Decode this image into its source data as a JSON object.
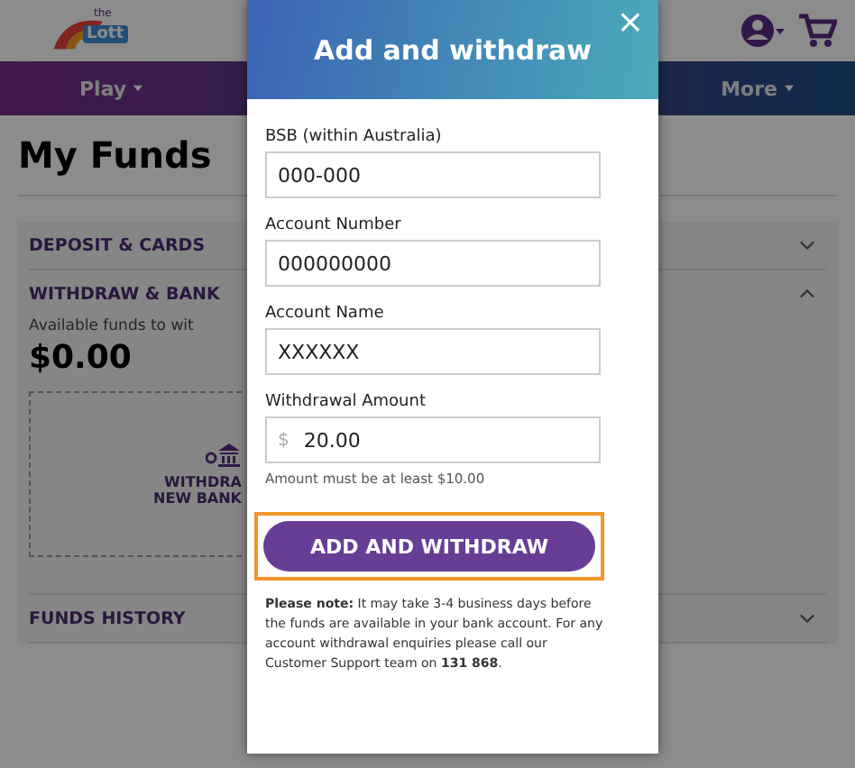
{
  "header": {
    "logo": {
      "small": "the",
      "big": "Lott"
    }
  },
  "nav": [
    {
      "label": "Play"
    },
    {
      "label": "More"
    }
  ],
  "page": {
    "title": "My Funds",
    "sections": [
      {
        "title": "DEPOSIT & CARDS",
        "expanded": false
      },
      {
        "title": "WITHDRAW & BANK",
        "expanded": true,
        "available_label": "Available funds to wit",
        "amount": "$0.00",
        "add_card": [
          "WITHDRA",
          "NEW BANK"
        ]
      },
      {
        "title": "FUNDS HISTORY",
        "expanded": false
      }
    ]
  },
  "modal": {
    "title": "Add and withdraw",
    "close": "×",
    "fields": [
      {
        "label": "BSB (within Australia)",
        "value": "000-000"
      },
      {
        "label": "Account Number",
        "value": "000000000"
      },
      {
        "label": "Account Name",
        "value": "XXXXXX"
      },
      {
        "label": "Withdrawal Amount",
        "prefix": "$",
        "value": "20.00",
        "hint": "Amount must be at least $10.00"
      }
    ],
    "button": "ADD AND WITHDRAW",
    "note": "**Please note:** It may take 3-4 business days before the funds are available in your bank account. For any account withdrawal enquiries please call our Customer Support team on **131 868**."
  }
}
